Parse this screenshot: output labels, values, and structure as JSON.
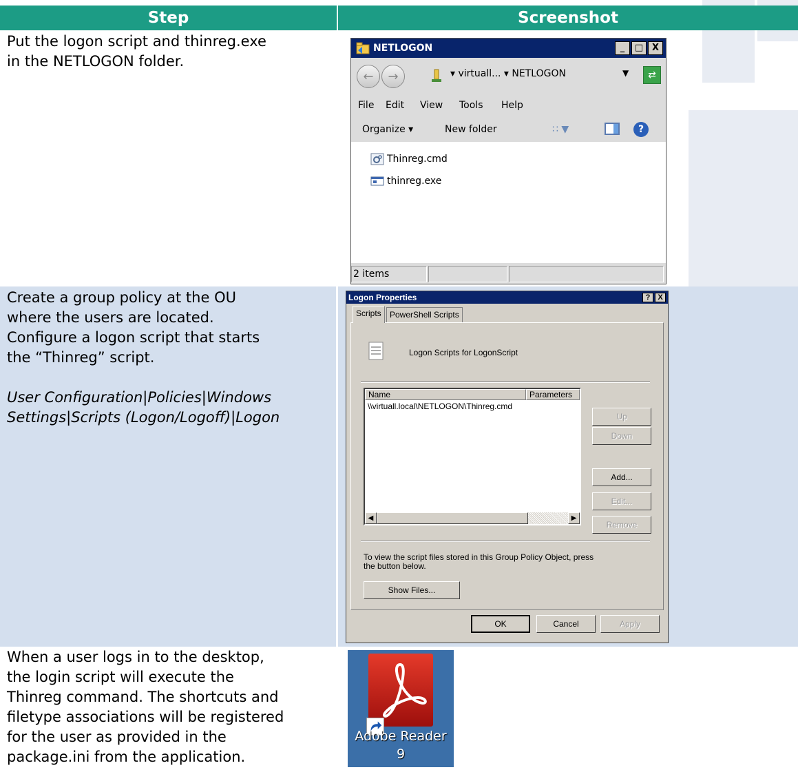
{
  "table": {
    "headers": [
      "Step",
      "Screenshot"
    ],
    "rows": [
      {
        "step_lines": [
          "Put the logon script and thinreg.exe",
          "in the NETLOGON folder."
        ]
      },
      {
        "step_lines": [
          "Create a group policy at the OU",
          "where the users are located.",
          "Configure a logon script that starts",
          "the “Thinreg” script."
        ],
        "italic_lines": [
          "User Configuration|Policies|Windows",
          "Settings|Scripts (Logon/Logoff)|Logon"
        ]
      },
      {
        "step_lines": [
          "When a user logs in to the desktop,",
          "the login script will execute the",
          "Thinreg command. The shortcuts and",
          "filetype associations will be registered",
          "for the user as provided in the",
          "package.ini from the application."
        ]
      }
    ]
  },
  "explorer": {
    "title": "NETLOGON",
    "window_buttons": [
      "_",
      "□",
      "X"
    ],
    "breadcrumb": "▾ virtuall... ▾ NETLOGON",
    "menu": [
      "File",
      "Edit",
      "View",
      "Tools",
      "Help"
    ],
    "toolbar": {
      "organize": "Organize ▾",
      "new_folder": "New folder"
    },
    "files": [
      "Thinreg.cmd",
      "thinreg.exe"
    ],
    "status": "2 items"
  },
  "dialog": {
    "title": "Logon Properties",
    "title_buttons": [
      "?",
      "X"
    ],
    "tabs": [
      "Scripts",
      "PowerShell Scripts"
    ],
    "heading": "Logon Scripts for LogonScript",
    "columns": [
      "Name",
      "Parameters"
    ],
    "scripts": [
      "\\\\virtuall.local\\NETLOGON\\Thinreg.cmd"
    ],
    "side_buttons": {
      "up": "Up",
      "down": "Down",
      "add": "Add...",
      "edit": "Edit...",
      "remove": "Remove"
    },
    "info_lines": [
      "To view the script files stored in this Group Policy Object, press",
      "the button below."
    ],
    "show_files": "Show Files...",
    "ok": "OK",
    "cancel": "Cancel",
    "apply": "Apply"
  },
  "desktop_icon": {
    "label_lines": [
      "Adobe Reader",
      "9"
    ]
  },
  "colors": {
    "header_bg": "#1c9c85",
    "row_shade": "#d4dfee",
    "title_bar": "#08246b"
  }
}
